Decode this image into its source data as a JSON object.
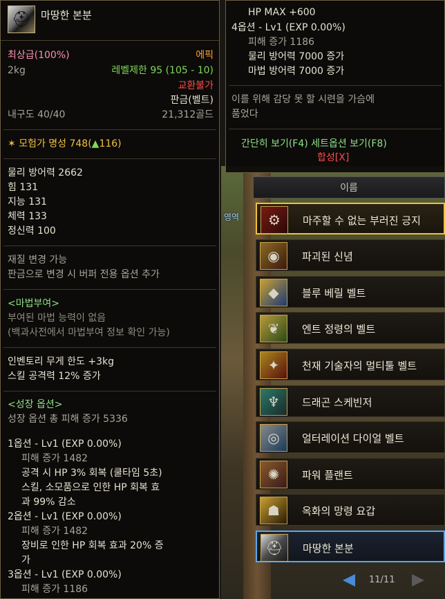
{
  "item": {
    "name": "마땅한 본분",
    "grade": "최상급(100%)",
    "rarity": "에픽",
    "weight": "2kg",
    "level_limit": "레벨제한 95 (105 - 10)",
    "trade": "교환불가",
    "category": "판금(벨트)",
    "durability": "내구도 40/40",
    "price": "21,312골드",
    "fame": "모험가 명성 748(",
    "fame_delta": "116)",
    "stats": [
      "물리 방어력 2662",
      "힘 131",
      "지능 131",
      "체력 133",
      "정신력 100"
    ],
    "material": [
      "재질 변경 가능",
      "판금으로 변경 시 버퍼 전용 옵션 추가"
    ],
    "enchant_title": "<마법부여>",
    "enchant": [
      "부여된 마법 능력이 없음",
      "(백과사전에서 마법부여 정보 확인 가능)"
    ],
    "extra": [
      "인벤토리 무게 한도 +3kg",
      "스킬 공격력 12% 증가"
    ],
    "growth_title": "<성장 옵션>",
    "growth_total": "성장 옵션 총 피해 증가 5336",
    "opt1": [
      "1옵션 - Lv1 (EXP 0.00%)",
      "피해 증가 1482",
      "공격 시 HP 3% 회복 (쿨타임 5초)",
      "스킬, 소모품으로 인한 HP 회복 효",
      "과 99% 감소"
    ],
    "opt2": [
      "2옵션 - Lv1 (EXP 0.00%)",
      "피해 증가 1482",
      "장비로 인한 HP 회복 효과 20% 증",
      "가"
    ],
    "opt3": [
      "3옵션 - Lv1 (EXP 0.00%)",
      "피해 증가 1186"
    ]
  },
  "tooltip2": {
    "hp_max": "HP MAX +600",
    "opt4": [
      "4옵션 - Lv1 (EXP 0.00%)",
      "피해 증가 1186",
      "물리 방어력 7000 증가",
      "마법 방어력 7000 증가"
    ],
    "flavor": [
      "이를 위해 감당 못 할 시련을 가슴에",
      "품었다"
    ],
    "actions": "간단히 보기(F4) 세트옵션 보기(F8)",
    "craft": "합성[X]"
  },
  "list": {
    "header": "이름",
    "scene_tag": "영역",
    "items": [
      {
        "label": "마주할 수 없는 부러진 긍지",
        "icon": "belt-red-icon"
      },
      {
        "label": "파괴된 신념",
        "icon": "belt-eye-icon"
      },
      {
        "label": "블루 베릴 벨트",
        "icon": "belt-blue-icon"
      },
      {
        "label": "엔트 정령의 벨트",
        "icon": "belt-leaf-icon"
      },
      {
        "label": "천재 기술자의 멀티툴 벨트",
        "icon": "belt-tool-icon"
      },
      {
        "label": "드래곤 스케빈저",
        "icon": "belt-dragon-icon"
      },
      {
        "label": "얼터레이션 다이얼 벨트",
        "icon": "belt-dial-icon"
      },
      {
        "label": "파워 플랜트",
        "icon": "belt-plant-icon"
      },
      {
        "label": "옥화의 망령 요갑",
        "icon": "belt-jaw-icon"
      },
      {
        "label": "마땅한 본분",
        "icon": "belt-helmet-icon"
      }
    ],
    "page": "11/11"
  }
}
